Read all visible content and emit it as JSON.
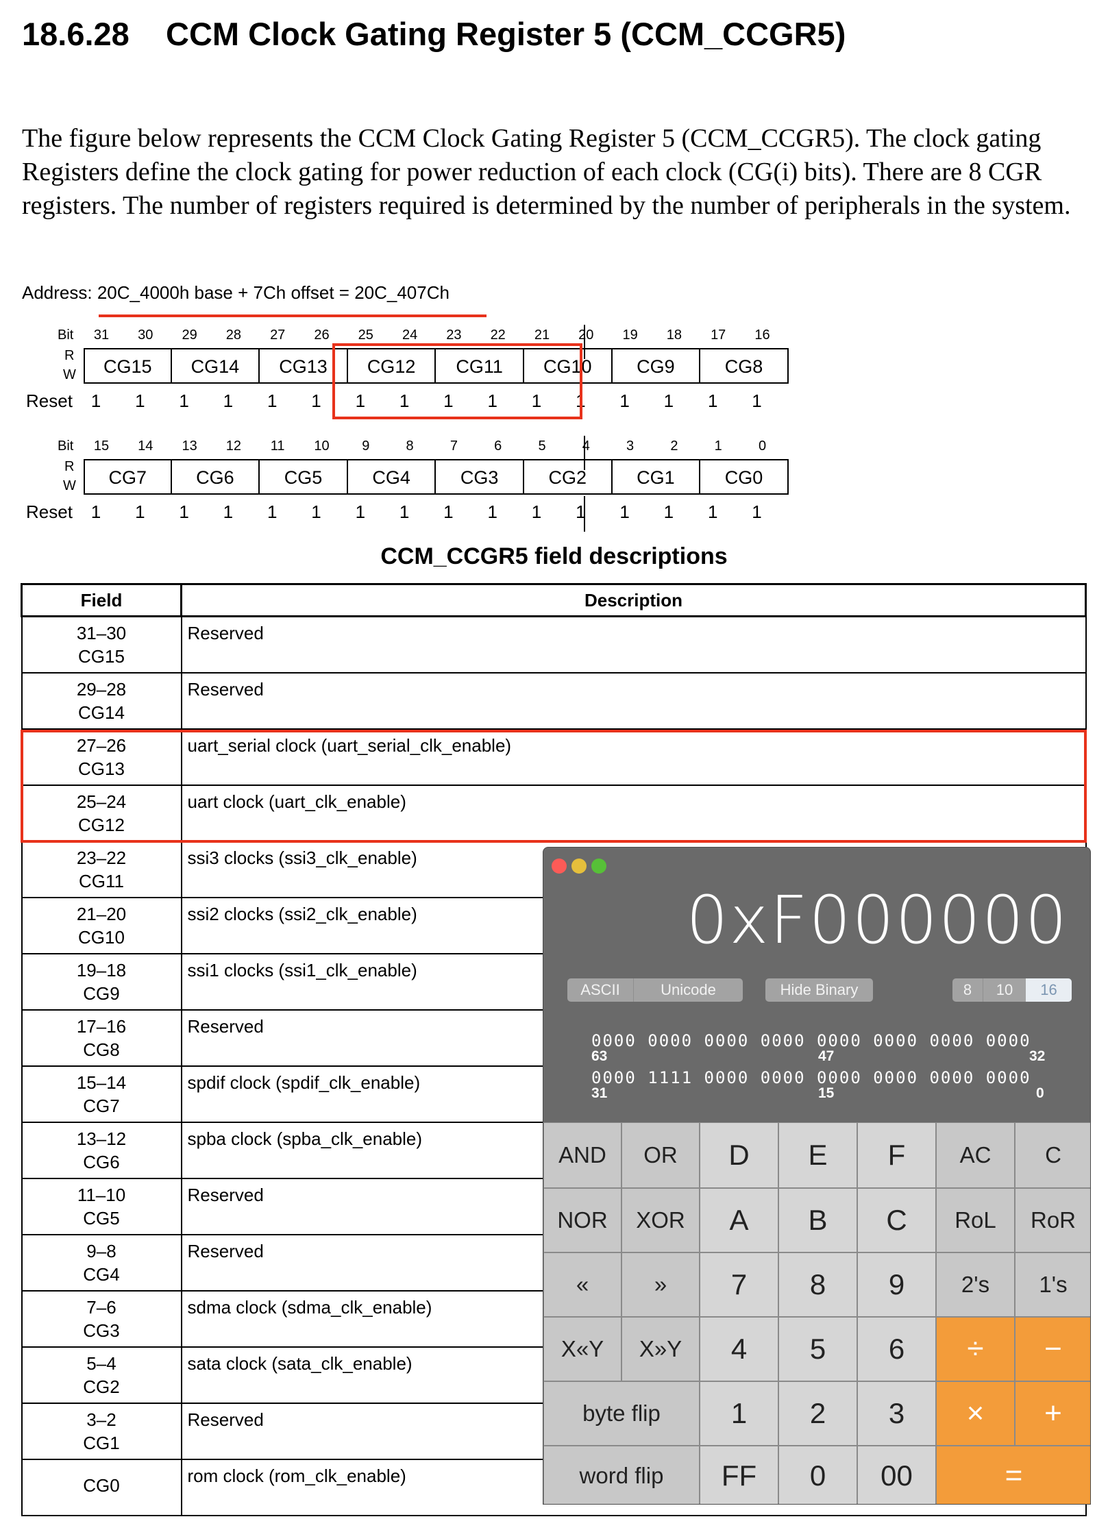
{
  "section": {
    "number": "18.6.28",
    "title": "CCM Clock Gating Register 5 (CCM_CCGR5)"
  },
  "intro": "The figure below represents the CCM Clock Gating Register 5 (CCM_CCGR5). The clock gating Registers define the clock gating for power reduction of each clock (CG(i) bits). There are 8 CGR registers. The number of registers required is determined by the number of peripherals in the system.",
  "address": "Address: 20C_4000h base + 7Ch offset = 20C_407Ch",
  "register": {
    "labels": {
      "bit": "Bit",
      "r": "R",
      "w": "W",
      "reset": "Reset"
    },
    "upper": {
      "bits": [
        "31",
        "30",
        "29",
        "28",
        "27",
        "26",
        "25",
        "24",
        "23",
        "22",
        "21",
        "20",
        "19",
        "18",
        "17",
        "16"
      ],
      "fields": [
        "CG15",
        "CG14",
        "CG13",
        "CG12",
        "CG11",
        "CG10",
        "CG9",
        "CG8"
      ],
      "reset": [
        "1",
        "1",
        "1",
        "1",
        "1",
        "1",
        "1",
        "1",
        "1",
        "1",
        "1",
        "1",
        "1",
        "1",
        "1",
        "1"
      ]
    },
    "lower": {
      "bits": [
        "15",
        "14",
        "13",
        "12",
        "11",
        "10",
        "9",
        "8",
        "7",
        "6",
        "5",
        "4",
        "3",
        "2",
        "1",
        "0"
      ],
      "fields": [
        "CG7",
        "CG6",
        "CG5",
        "CG4",
        "CG3",
        "CG2",
        "CG1",
        "CG0"
      ],
      "reset": [
        "1",
        "1",
        "1",
        "1",
        "1",
        "1",
        "1",
        "1",
        "1",
        "1",
        "1",
        "1",
        "1",
        "1",
        "1",
        "1"
      ]
    }
  },
  "table": {
    "caption": "CCM_CCGR5 field descriptions",
    "headers": {
      "field": "Field",
      "description": "Description"
    },
    "rows": [
      {
        "bits": "31–30",
        "name": "CG15",
        "desc": "Reserved"
      },
      {
        "bits": "29–28",
        "name": "CG14",
        "desc": "Reserved"
      },
      {
        "bits": "27–26",
        "name": "CG13",
        "desc": "uart_serial clock (uart_serial_clk_enable)"
      },
      {
        "bits": "25–24",
        "name": "CG12",
        "desc": "uart clock (uart_clk_enable)"
      },
      {
        "bits": "23–22",
        "name": "CG11",
        "desc": "ssi3 clocks (ssi3_clk_enable)"
      },
      {
        "bits": "21–20",
        "name": "CG10",
        "desc": "ssi2 clocks (ssi2_clk_enable)"
      },
      {
        "bits": "19–18",
        "name": "CG9",
        "desc": "ssi1 clocks (ssi1_clk_enable)"
      },
      {
        "bits": "17–16",
        "name": "CG8",
        "desc": "Reserved"
      },
      {
        "bits": "15–14",
        "name": "CG7",
        "desc": "spdif clock (spdif_clk_enable)"
      },
      {
        "bits": "13–12",
        "name": "CG6",
        "desc": "spba clock (spba_clk_enable)"
      },
      {
        "bits": "11–10",
        "name": "CG5",
        "desc": "Reserved"
      },
      {
        "bits": "9–8",
        "name": "CG4",
        "desc": "Reserved"
      },
      {
        "bits": "7–6",
        "name": "CG3",
        "desc": "sdma clock (sdma_clk_enable)"
      },
      {
        "bits": "5–4",
        "name": "CG2",
        "desc": "sata clock (sata_clk_enable)"
      },
      {
        "bits": "3–2",
        "name": "CG1",
        "desc": "Reserved"
      },
      {
        "bits": "",
        "name": "CG0",
        "desc": "rom clock (rom_clk_enable)"
      }
    ]
  },
  "calculator": {
    "display": "0xF000000",
    "buttons": {
      "ascii": "ASCII",
      "unicode": "Unicode",
      "hide_binary": "Hide Binary",
      "base8": "8",
      "base10": "10",
      "base16": "16"
    },
    "selected_base": "16",
    "binary": {
      "row1": "0000 0000 0000 0000 0000 0000 0000 0000",
      "row1_labels": [
        "63",
        "47",
        "32"
      ],
      "row2": "0000 1111 0000 0000 0000 0000 0000 0000",
      "row2_labels": [
        "31",
        "15",
        "0"
      ]
    },
    "keys": {
      "and": "AND",
      "or": "OR",
      "d": "D",
      "e": "E",
      "f": "F",
      "ac": "AC",
      "c": "C",
      "nor": "NOR",
      "xor": "XOR",
      "a": "A",
      "b": "B",
      "cc": "C",
      "rol": "RoL",
      "ror": "RoR",
      "shl": "«",
      "shr": "»",
      "n7": "7",
      "n8": "8",
      "n9": "9",
      "twos": "2's",
      "ones": "1's",
      "xshly": "X«Y",
      "xshry": "X»Y",
      "n4": "4",
      "n5": "5",
      "n6": "6",
      "div": "÷",
      "minus": "−",
      "byteflip": "byte flip",
      "n1": "1",
      "n2": "2",
      "n3": "3",
      "mul": "×",
      "plus": "+",
      "wordflip": "word flip",
      "ff": "FF",
      "n0": "0",
      "n00": "00",
      "eq": "="
    },
    "colors": {
      "close": "#fc5b57",
      "minimize": "#e5bf3c",
      "zoom": "#57c038",
      "operator": "#f39c3a"
    }
  }
}
